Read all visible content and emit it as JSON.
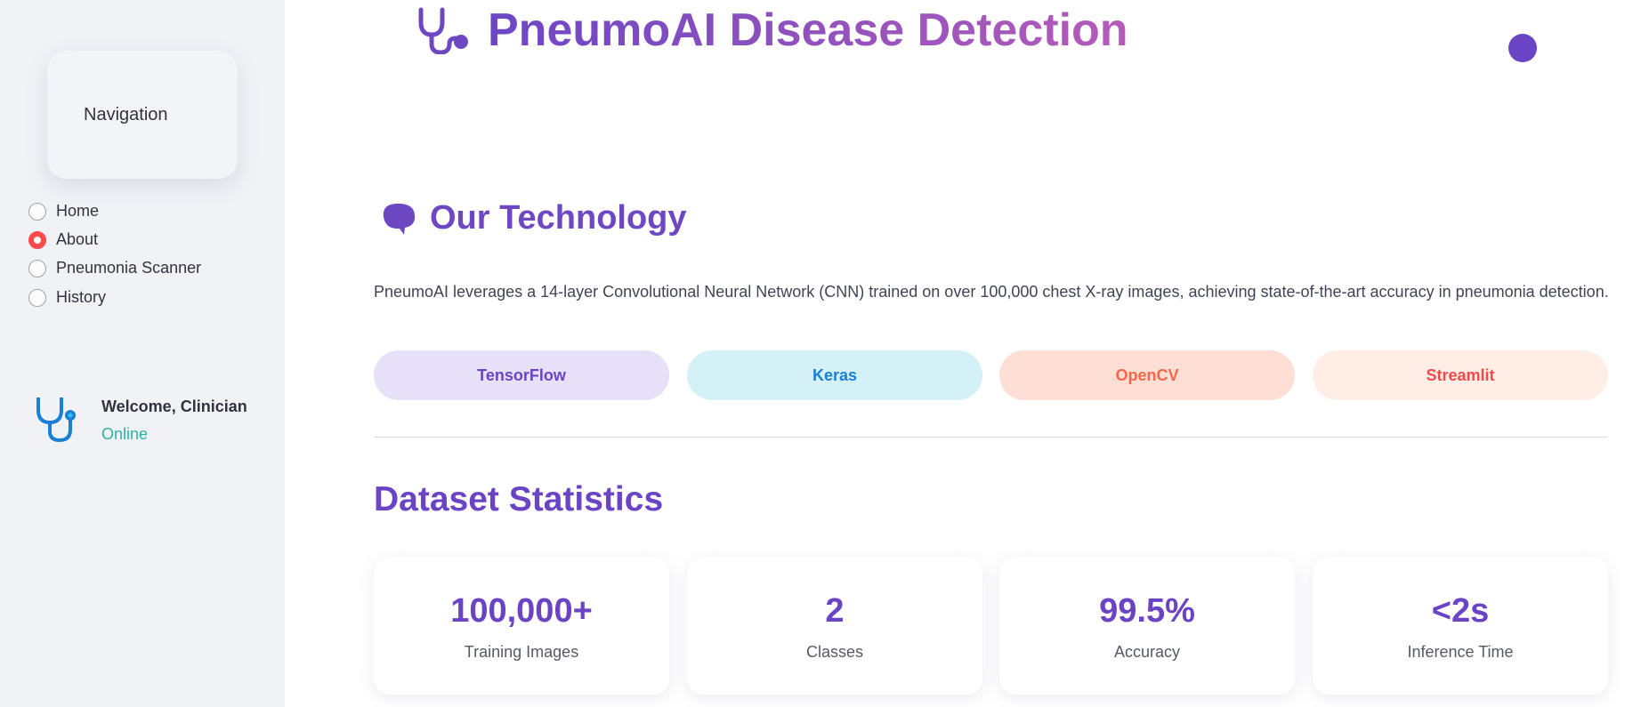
{
  "sidebar": {
    "nav_title": "Navigation",
    "items": [
      {
        "label": "Home",
        "selected": false
      },
      {
        "label": "About",
        "selected": true
      },
      {
        "label": "Pneumonia Scanner",
        "selected": false
      },
      {
        "label": "History",
        "selected": false
      }
    ],
    "user_name": "Welcome, Clinician",
    "user_status": "Online"
  },
  "header": {
    "title": "PneumoAI Disease Detection"
  },
  "technology": {
    "heading": "Our Technology",
    "description": "PneumoAI leverages a 14-layer Convolutional Neural Network (CNN) trained on over 100,000 chest X-ray images, achieving state-of-the-art accuracy in pneumonia detection.",
    "pills": [
      {
        "label": "TensorFlow",
        "bg": "#e6e0f8",
        "color": "#6a44c4"
      },
      {
        "label": "Keras",
        "bg": "#d4f1f7",
        "color": "#1a7fd6"
      },
      {
        "label": "OpenCV",
        "bg": "#ffdfd5",
        "color": "#f0694a"
      },
      {
        "label": "Streamlit",
        "bg": "#ffede6",
        "color": "#f24a4a"
      }
    ]
  },
  "stats": {
    "heading": "Dataset Statistics",
    "cards": [
      {
        "value": "100,000+",
        "label": "Training Images"
      },
      {
        "value": "2",
        "label": "Classes"
      },
      {
        "value": "99.5%",
        "label": "Accuracy"
      },
      {
        "value": "<2s",
        "label": "Inference Time"
      }
    ]
  }
}
